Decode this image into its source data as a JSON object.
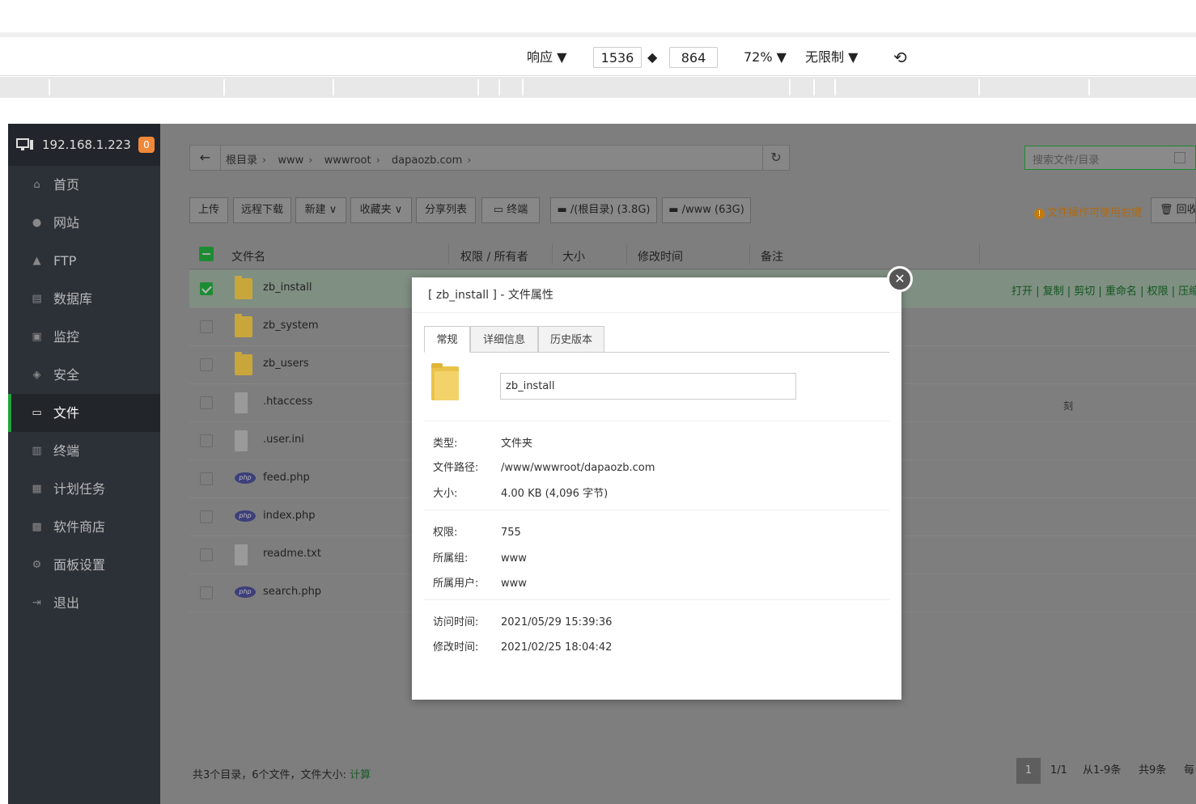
{
  "devtools": {
    "responsive_label": "响应 ▼",
    "width": "1536",
    "height": "864",
    "swap_glyph": "◆",
    "zoom": "72% ▼",
    "throttle": "无限制 ▼",
    "rotate_glyph": "⟲"
  },
  "sidebar": {
    "ip": "192.168.1.223",
    "badge": "0",
    "items": [
      {
        "label": "首页",
        "icon": "⌂"
      },
      {
        "label": "网站",
        "icon": "●"
      },
      {
        "label": "FTP",
        "icon": "▲"
      },
      {
        "label": "数据库",
        "icon": "▤"
      },
      {
        "label": "监控",
        "icon": "▣"
      },
      {
        "label": "安全",
        "icon": "◈"
      },
      {
        "label": "文件",
        "icon": "▭"
      },
      {
        "label": "终端",
        "icon": "▥"
      },
      {
        "label": "计划任务",
        "icon": "▦"
      },
      {
        "label": "软件商店",
        "icon": "▩"
      },
      {
        "label": "面板设置",
        "icon": "⚙"
      },
      {
        "label": "退出",
        "icon": "⇥"
      }
    ]
  },
  "breadcrumb": {
    "back": "←",
    "parts": [
      "根目录",
      "www",
      "wwwroot",
      "dapaozb.com"
    ],
    "refresh": "↻"
  },
  "search": {
    "placeholder": "搜索文件/目录"
  },
  "toolbar": {
    "buttons": [
      "上传",
      "远程下载",
      "新建 ∨",
      "收藏夹 ∨",
      "分享列表",
      "▭ 终端",
      "▬ /(根目录) (3.8G)",
      "▬ /www (63G)"
    ],
    "tip": "文件操作可使用右键",
    "tip_icon": "!",
    "recycle": "🗑 回收"
  },
  "table": {
    "headers": [
      "文件名",
      "权限 / 所有者",
      "大小",
      "修改时间",
      "备注"
    ],
    "rows": [
      {
        "name": "zb_install",
        "type": "folder",
        "selected": true
      },
      {
        "name": "zb_system",
        "type": "folder",
        "selected": false
      },
      {
        "name": "zb_users",
        "type": "folder",
        "selected": false
      },
      {
        "name": ".htaccess",
        "type": "doc",
        "selected": false
      },
      {
        "name": ".user.ini",
        "type": "doc",
        "selected": false
      },
      {
        "name": "feed.php",
        "type": "php",
        "selected": false
      },
      {
        "name": "index.php",
        "type": "php",
        "selected": false
      },
      {
        "name": "readme.txt",
        "type": "doc",
        "selected": false
      },
      {
        "name": "search.php",
        "type": "php",
        "selected": false
      }
    ],
    "row_ops": "打开 | 复制 | 剪切 | 重命名 | 权限 | 压缩 |",
    "php_label": "php",
    "stray_char": "刻"
  },
  "footer": {
    "summary": "共3个目录，6个文件，文件大小:",
    "calc": "计算",
    "page_current": "1",
    "page_total": "1/1",
    "range": "从1-9条",
    "count": "共9条",
    "per": "每"
  },
  "modal": {
    "close": "✕",
    "title": "[ zb_install ] - 文件属性",
    "tabs": [
      "常规",
      "详细信息",
      "历史版本"
    ],
    "name_value": "zb_install",
    "props": [
      {
        "k": "类型:",
        "v": "文件夹"
      },
      {
        "k": "文件路径:",
        "v": "/www/wwwroot/dapaozb.com"
      },
      {
        "k": "大小:",
        "v": "4.00 KB (4,096 字节)"
      },
      {
        "k": "权限:",
        "v": "755"
      },
      {
        "k": "所属组:",
        "v": "www"
      },
      {
        "k": "所属用户:",
        "v": "www"
      },
      {
        "k": "访问时间:",
        "v": "2021/05/29 15:39:36"
      },
      {
        "k": "修改时间:",
        "v": "2021/02/25 18:04:42"
      }
    ]
  }
}
